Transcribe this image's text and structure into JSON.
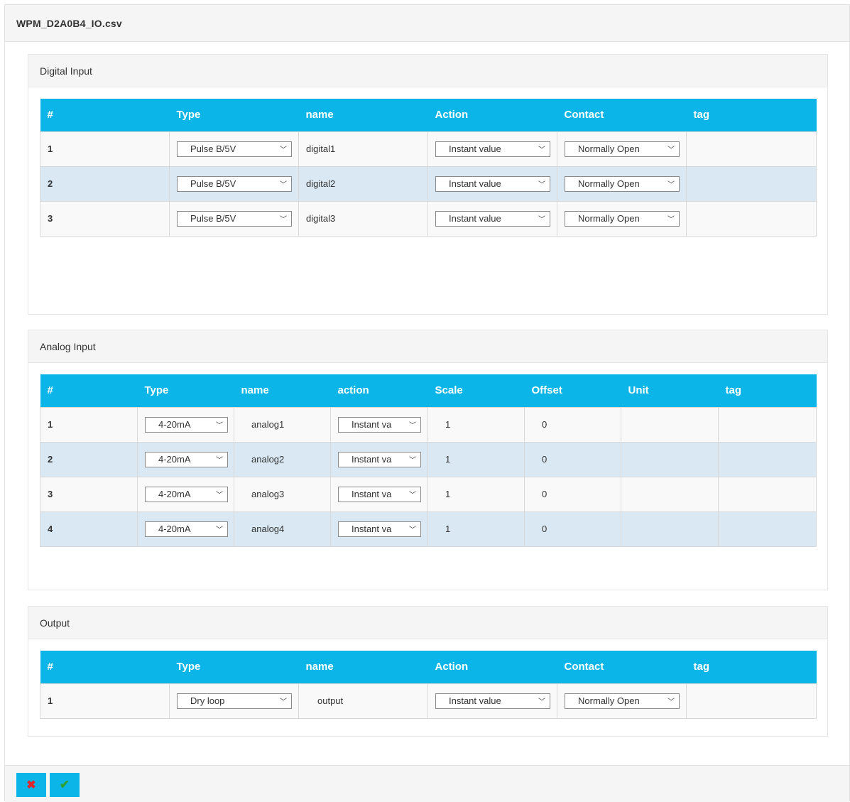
{
  "dialog": {
    "title": "WPM_D2A0B4_IO.csv"
  },
  "digital_input": {
    "heading": "Digital Input",
    "columns": [
      "#",
      "Type",
      "name",
      "Action",
      "Contact",
      "tag"
    ],
    "rows": [
      {
        "num": "1",
        "type": "Pulse B/5V",
        "name": "digital1",
        "action": "Instant value",
        "contact": "Normally Open",
        "tag": ""
      },
      {
        "num": "2",
        "type": "Pulse B/5V",
        "name": "digital2",
        "action": "Instant value",
        "contact": "Normally Open",
        "tag": ""
      },
      {
        "num": "3",
        "type": "Pulse B/5V",
        "name": "digital3",
        "action": "Instant value",
        "contact": "Normally Open",
        "tag": ""
      }
    ]
  },
  "analog_input": {
    "heading": "Analog Input",
    "columns": [
      "#",
      "Type",
      "name",
      "action",
      "Scale",
      "Offset",
      "Unit",
      "tag"
    ],
    "rows": [
      {
        "num": "1",
        "type": "4-20mA",
        "name": "analog1",
        "action": "Instant va",
        "scale": "1",
        "offset": "0",
        "unit": "",
        "tag": ""
      },
      {
        "num": "2",
        "type": "4-20mA",
        "name": "analog2",
        "action": "Instant va",
        "scale": "1",
        "offset": "0",
        "unit": "",
        "tag": ""
      },
      {
        "num": "3",
        "type": "4-20mA",
        "name": "analog3",
        "action": "Instant va",
        "scale": "1",
        "offset": "0",
        "unit": "",
        "tag": ""
      },
      {
        "num": "4",
        "type": "4-20mA",
        "name": "analog4",
        "action": "Instant va",
        "scale": "1",
        "offset": "0",
        "unit": "",
        "tag": ""
      }
    ]
  },
  "output": {
    "heading": "Output",
    "columns": [
      "#",
      "Type",
      "name",
      "Action",
      "Contact",
      "tag"
    ],
    "rows": [
      {
        "num": "1",
        "type": "Dry loop",
        "name": "output",
        "action": "Instant value",
        "contact": "Normally Open",
        "tag": ""
      }
    ]
  },
  "footer": {
    "cancel_icon": "✖",
    "confirm_icon": "✔"
  },
  "colors": {
    "header_blue": "#0bb5e8",
    "row_alt": "#d9e8f2",
    "cancel_red": "#e0242a",
    "confirm_green": "#2fa02f"
  }
}
